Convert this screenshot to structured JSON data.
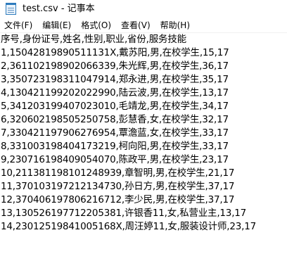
{
  "window": {
    "title": "test.csv - 记事本",
    "icon": "notepad-icon"
  },
  "menubar": {
    "items": [
      {
        "label": "文件(F)"
      },
      {
        "label": "编辑(E)"
      },
      {
        "label": "格式(O)"
      },
      {
        "label": "查看(V)"
      },
      {
        "label": "帮助(H)"
      }
    ]
  },
  "document": {
    "lines": [
      "序号,身份证号,姓名,性别,职业,省份,服务技能",
      "1,15042819890511131X,戴苏阳,男,在校学生,15,17",
      "2,361102198902066339,朱光辉,男,在校学生,36,17",
      "3,350723198311047914,郑永进,男,在校学生,35,17",
      "4,130421199202022990,陆云波,男,在校学生,13,17",
      "5,341203199407023010,毛靖龙,男,在校学生,34,17",
      "6,320602198505250758,彭慧香,女,在校学生,32,17",
      "7,330421197906276954,覃澹蓝,女,在校学生,33,17",
      "8,331003198404173219,柯向阳,男,在校学生,33,17",
      "9,230716198409054070,陈政平,男,在校学生,23,17",
      "10,211381198101248939,章智明,男,在校学生,21,17",
      "11,370103197212134730,孙日方,男,在校学生,37,17",
      "12,370406197806216712,李少民,男,在校学生,37,17",
      "13,130526197712205381,许银香11,女,私营业主,13,17",
      "14,23012519841005168X,周汪婷11,女,服装设计师,23,17"
    ]
  }
}
